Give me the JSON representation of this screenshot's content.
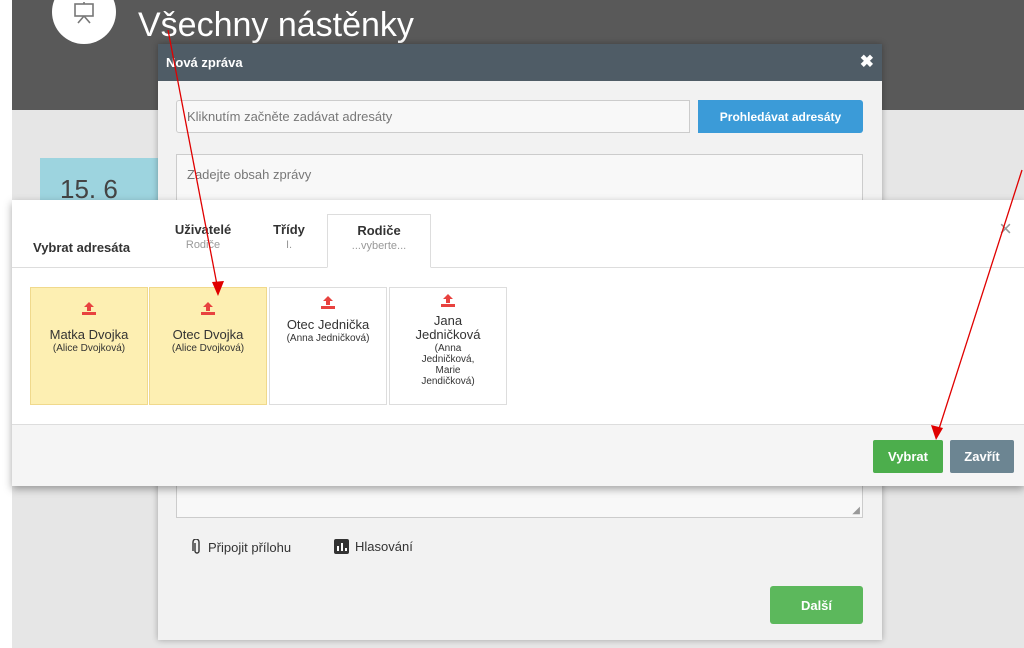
{
  "background": {
    "page_title": "Všechny nástěnky",
    "tile_text": "15. 6"
  },
  "new_message": {
    "title": "Nová zpráva",
    "close": "✖",
    "recipients_placeholder": "Kliknutím začněte zadávat adresáty",
    "search_button": "Prohledávat adresáty",
    "content_placeholder": "Zadejte obsah zprávy",
    "attach_label": "Připojit přílohu",
    "poll_label": "Hlasování",
    "next_button": "Další"
  },
  "picker": {
    "label": "Vybrat adresáta",
    "close": "×",
    "tabs": [
      {
        "label": "Uživatelé",
        "sub": "Rodiče"
      },
      {
        "label": "Třídy",
        "sub": "I."
      },
      {
        "label": "Rodiče",
        "sub": "...vyberte..."
      }
    ],
    "cards": [
      {
        "name": "Matka Dvojka",
        "sub": "(Alice Dvojková)",
        "selected": true
      },
      {
        "name": "Otec Dvojka",
        "sub": "(Alice Dvojková)",
        "selected": true
      },
      {
        "name": "Otec Jednička",
        "sub": "(Anna Jedničková)",
        "selected": false
      },
      {
        "name": "Jana Jedničková",
        "sub": "(Anna Jedničková, Marie Jendičková)",
        "selected": false
      }
    ],
    "select_button": "Vybrat",
    "close_button": "Zavřít"
  },
  "colors": {
    "accent_red": "#e8423f",
    "selected_bg": "#fdefb2",
    "annotation_arrow": "#e00000"
  }
}
